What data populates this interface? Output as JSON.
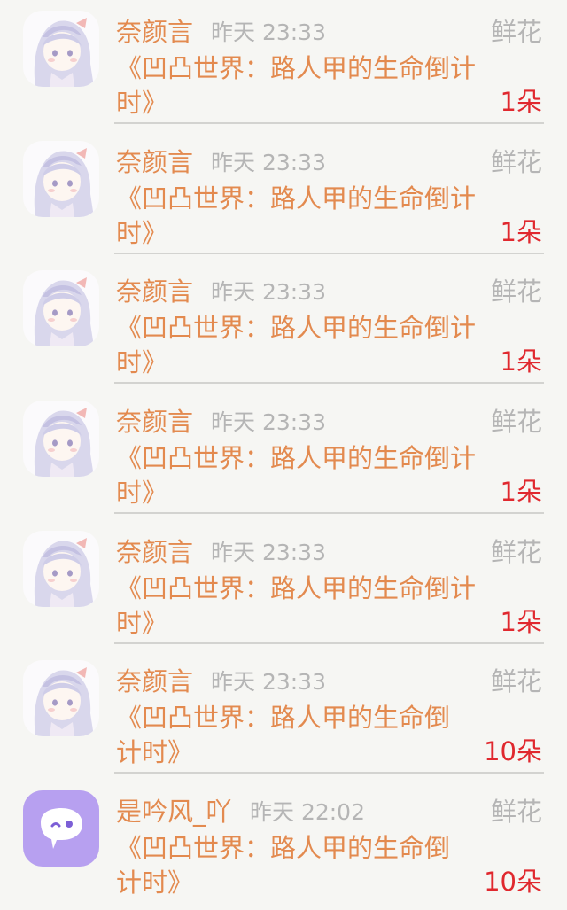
{
  "items": [
    {
      "user": "奈颜言",
      "time": "昨天 23:33",
      "type": "鲜花",
      "book": "《凹凸世界：路人甲的生命倒计时》",
      "count": "1朵",
      "avatar_icon": "anime-girl-avatar-icon"
    },
    {
      "user": "奈颜言",
      "time": "昨天 23:33",
      "type": "鲜花",
      "book": "《凹凸世界：路人甲的生命倒计时》",
      "count": "1朵",
      "avatar_icon": "anime-girl-avatar-icon"
    },
    {
      "user": "奈颜言",
      "time": "昨天 23:33",
      "type": "鲜花",
      "book": "《凹凸世界：路人甲的生命倒计时》",
      "count": "1朵",
      "avatar_icon": "anime-girl-avatar-icon"
    },
    {
      "user": "奈颜言",
      "time": "昨天 23:33",
      "type": "鲜花",
      "book": "《凹凸世界：路人甲的生命倒计时》",
      "count": "1朵",
      "avatar_icon": "anime-girl-avatar-icon"
    },
    {
      "user": "奈颜言",
      "time": "昨天 23:33",
      "type": "鲜花",
      "book": "《凹凸世界：路人甲的生命倒计时》",
      "count": "1朵",
      "avatar_icon": "anime-girl-avatar-icon"
    },
    {
      "user": "奈颜言",
      "time": "昨天 23:33",
      "type": "鲜花",
      "book": "《凹凸世界：路人甲的生命倒计时》",
      "count": "10朵",
      "avatar_icon": "anime-girl-avatar-icon"
    },
    {
      "user": "是吟风_吖",
      "time": "昨天 22:02",
      "type": "鲜花",
      "book": "《凹凸世界：路人甲的生命倒计时》",
      "count": "10朵",
      "avatar_icon": "chat-bubble-avatar-icon"
    }
  ],
  "colors": {
    "background": "#f6f6f3",
    "accent": "#e38a4f",
    "muted": "#b5b5b5",
    "count": "#e0282e",
    "divider": "#d3d3d0",
    "avatar_purple": "#b7a0f0"
  }
}
